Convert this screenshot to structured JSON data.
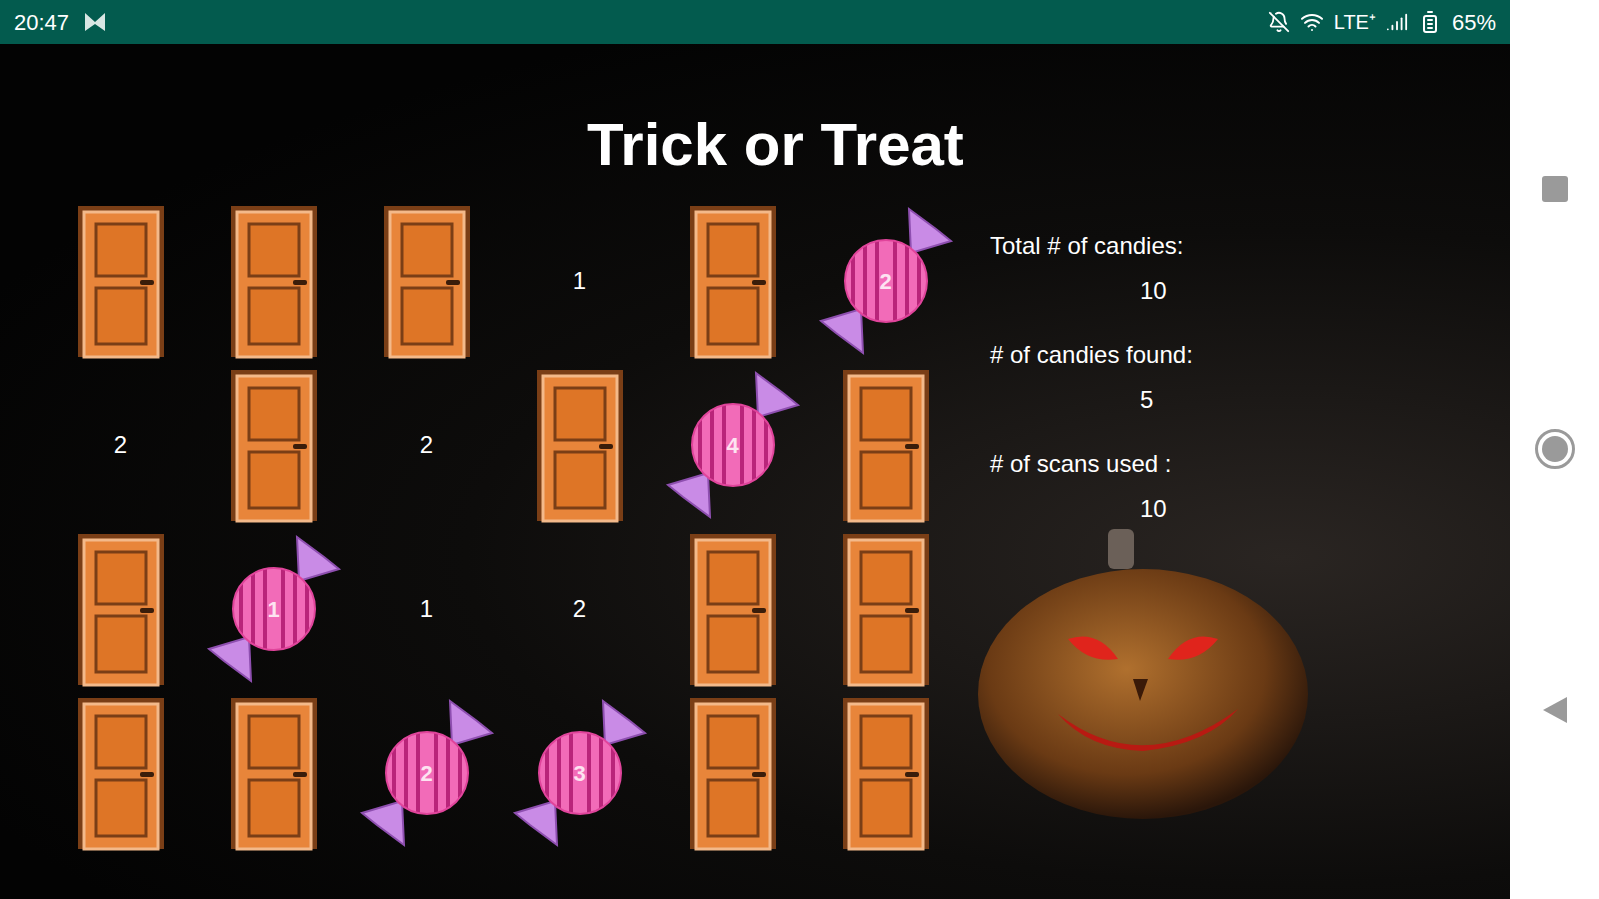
{
  "status_bar": {
    "time": "20:47",
    "network": "LTE⁺",
    "battery": "65%"
  },
  "title": "Trick or Treat",
  "board": {
    "rows": [
      [
        {
          "kind": "door"
        },
        {
          "kind": "door"
        },
        {
          "kind": "door"
        },
        {
          "kind": "number",
          "text": "1"
        },
        {
          "kind": "door"
        },
        {
          "kind": "candy",
          "text": "2"
        }
      ],
      [
        {
          "kind": "number",
          "text": "2"
        },
        {
          "kind": "door"
        },
        {
          "kind": "number",
          "text": "2"
        },
        {
          "kind": "door"
        },
        {
          "kind": "candy",
          "text": "4"
        },
        {
          "kind": "door"
        }
      ],
      [
        {
          "kind": "door"
        },
        {
          "kind": "candy",
          "text": "1"
        },
        {
          "kind": "number",
          "text": "1"
        },
        {
          "kind": "number",
          "text": "2"
        },
        {
          "kind": "door"
        },
        {
          "kind": "door"
        }
      ],
      [
        {
          "kind": "door"
        },
        {
          "kind": "door"
        },
        {
          "kind": "candy",
          "text": "2"
        },
        {
          "kind": "candy",
          "text": "3"
        },
        {
          "kind": "door"
        },
        {
          "kind": "door"
        }
      ]
    ]
  },
  "stats": [
    {
      "label": "Total # of candies:",
      "value": "10"
    },
    {
      "label": "# of candies found:",
      "value": "5"
    },
    {
      "label": "# of scans used :",
      "value": "10"
    }
  ]
}
